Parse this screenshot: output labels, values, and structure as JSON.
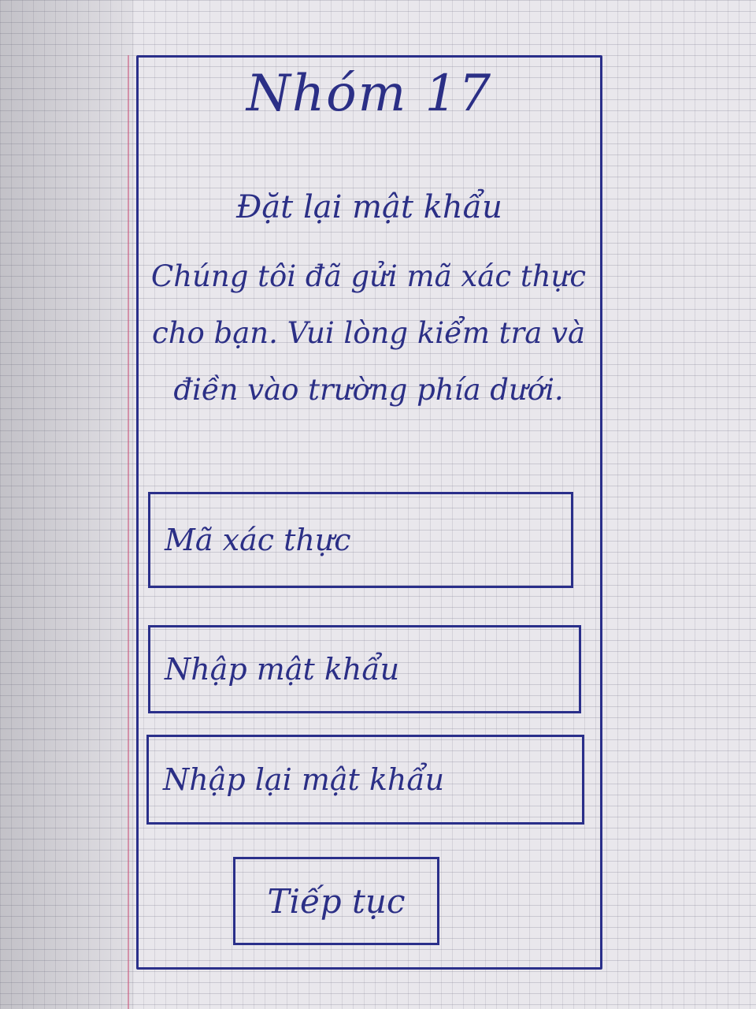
{
  "screen": {
    "title": "Nhóm 17",
    "heading": "Đặt lại mật khẩu",
    "description": "Chúng tôi đã gửi mã xác thực cho bạn. Vui lòng kiểm tra và điền vào trường phía dưới."
  },
  "form": {
    "verification_code_placeholder": "Mã xác thực",
    "new_password_placeholder": "Nhập mật khẩu",
    "confirm_password_placeholder": "Nhập lại mật khẩu"
  },
  "actions": {
    "continue_label": "Tiếp tục"
  },
  "colors": {
    "ink": "#2b2f86",
    "paper": "#e9e7ec"
  }
}
